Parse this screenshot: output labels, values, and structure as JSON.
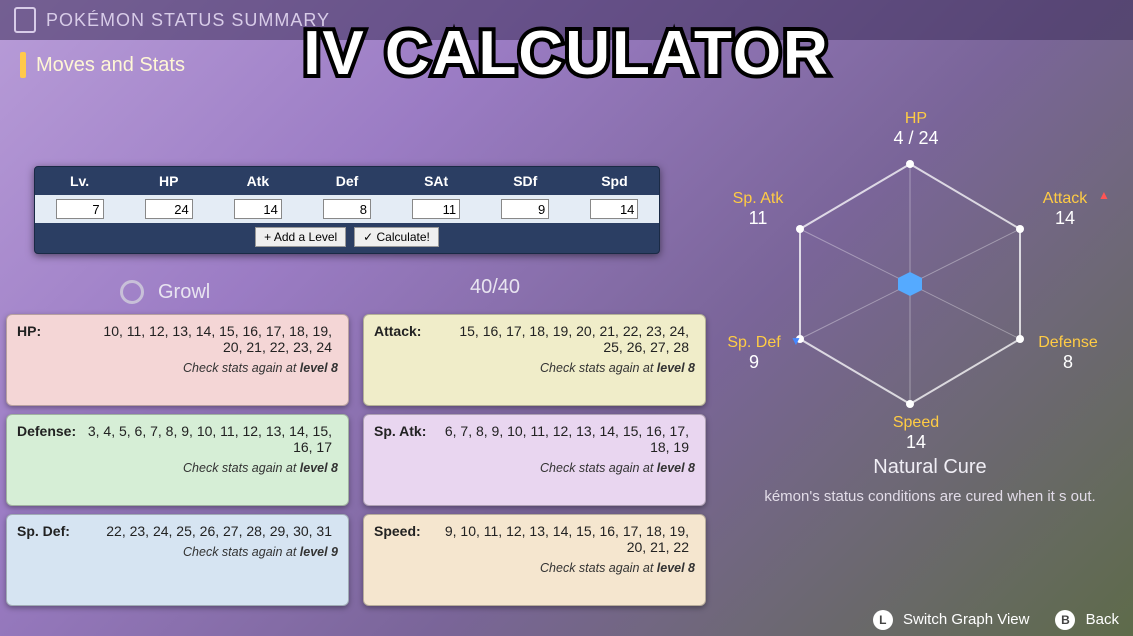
{
  "bg": {
    "header": "POKÉMON STATUS SUMMARY",
    "subheader": "Moves and Stats",
    "move_name": "Growl",
    "move_pp": "40/40"
  },
  "title": "IV CALCULATOR",
  "calc": {
    "headers": [
      "Lv.",
      "HP",
      "Atk",
      "Def",
      "SAt",
      "SDf",
      "Spd"
    ],
    "values": [
      "7",
      "24",
      "14",
      "8",
      "11",
      "9",
      "14"
    ],
    "add_btn": "+ Add a Level",
    "calc_btn": "✓ Calculate!"
  },
  "cards": [
    {
      "cls": "c-hp",
      "label": "HP:",
      "values": "10, 11, 12, 13, 14, 15, 16, 17, 18, 19, 20, 21, 22, 23, 24",
      "hint_pre": "Check stats again at ",
      "hint_lvl": "level 8"
    },
    {
      "cls": "c-atk",
      "label": "Attack:",
      "values": "15, 16, 17, 18, 19, 20, 21, 22, 23, 24, 25, 26, 27, 28",
      "hint_pre": "Check stats again at ",
      "hint_lvl": "level 8"
    },
    {
      "cls": "c-def",
      "label": "Defense:",
      "values": "3, 4, 5, 6, 7, 8, 9, 10, 11, 12, 13, 14, 15, 16, 17",
      "hint_pre": "Check stats again at ",
      "hint_lvl": "level 8"
    },
    {
      "cls": "c-satk",
      "label": "Sp. Atk:",
      "values": "6, 7, 8, 9, 10, 11, 12, 13, 14, 15, 16, 17, 18, 19",
      "hint_pre": "Check stats again at ",
      "hint_lvl": "level 8"
    },
    {
      "cls": "c-sdef",
      "label": "Sp. Def:",
      "values": "22, 23, 24, 25, 26, 27, 28, 29, 30, 31",
      "hint_pre": "Check stats again at ",
      "hint_lvl": "level 9"
    },
    {
      "cls": "c-spd",
      "label": "Speed:",
      "values": "9, 10, 11, 12, 13, 14, 15, 16, 17, 18, 19, 20, 21, 22",
      "hint_pre": "Check stats again at ",
      "hint_lvl": "level 8"
    }
  ],
  "radar": {
    "hp": {
      "name": "HP",
      "value": "4 / 24"
    },
    "atk": {
      "name": "Attack",
      "value": "14"
    },
    "def": {
      "name": "Defense",
      "value": "8"
    },
    "spd": {
      "name": "Speed",
      "value": "14"
    },
    "sdef": {
      "name": "Sp. Def",
      "value": "9"
    },
    "satk": {
      "name": "Sp. Atk",
      "value": "11"
    }
  },
  "ability": {
    "name": "Natural Cure",
    "desc": "kémon's status conditions are cured when it s out."
  },
  "footer": {
    "switch_btn": "L",
    "switch_txt": "Switch Graph View",
    "back_btn": "B",
    "back_txt": "Back"
  }
}
